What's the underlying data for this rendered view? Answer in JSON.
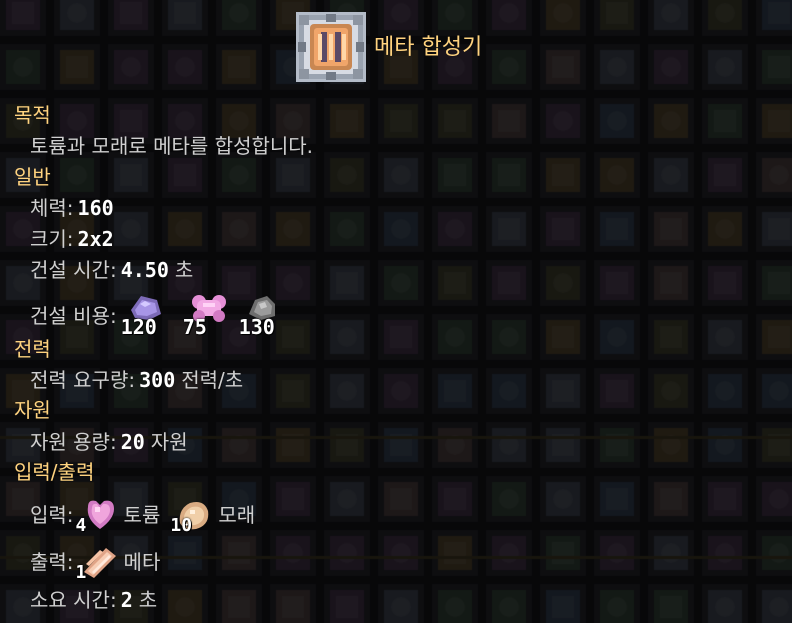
{
  "block": {
    "name": "메타 합성기",
    "icon": "meta-synthesizer-block-icon"
  },
  "sections": {
    "purpose": {
      "heading": "목적",
      "description": "토륨과 모래로 메타를 합성합니다."
    },
    "general": {
      "heading": "일반",
      "health_label": "체력:",
      "health_value": "160",
      "size_label": "크기:",
      "size_value": "2x2",
      "build_time_label": "건설 시간:",
      "build_time_value": "4.50",
      "build_time_unit": "초",
      "build_cost_label": "건설 비용:",
      "build_cost": [
        {
          "item": "plastanium",
          "icon": "plastanium-icon",
          "amount": "120",
          "color": "#9c8ad6"
        },
        {
          "item": "phase-fabric",
          "icon": "phase-fabric-icon",
          "amount": "75",
          "color": "#e58fd6"
        },
        {
          "item": "silicon",
          "icon": "silicon-icon",
          "amount": "130",
          "color": "#8d8d8d"
        }
      ]
    },
    "power": {
      "heading": "전력",
      "usage_label": "전력 요구량:",
      "usage_value": "300",
      "usage_unit": "전력/초"
    },
    "resources": {
      "heading": "자원",
      "capacity_label": "자원 용량:",
      "capacity_value": "20",
      "capacity_unit": "자원"
    },
    "io": {
      "heading": "입력/출력",
      "input_label": "입력:",
      "inputs": [
        {
          "name": "토륨",
          "icon": "thorium-icon",
          "amount": "4",
          "color": "#e89ccc"
        },
        {
          "name": "모래",
          "icon": "sand-icon",
          "amount": "10",
          "color": "#f0cfa8"
        }
      ],
      "output_label": "출력:",
      "output": {
        "name": "메타",
        "icon": "metaglass-icon",
        "amount": "1",
        "color": "#f5c2a4"
      },
      "craft_time_label": "소요 시간:",
      "craft_time_value": "2",
      "craft_time_unit": "초"
    }
  },
  "colors": {
    "heading": "#ffd37f",
    "text": "#d0d0d0",
    "value": "#ffffff",
    "background": "#0f0f10"
  }
}
